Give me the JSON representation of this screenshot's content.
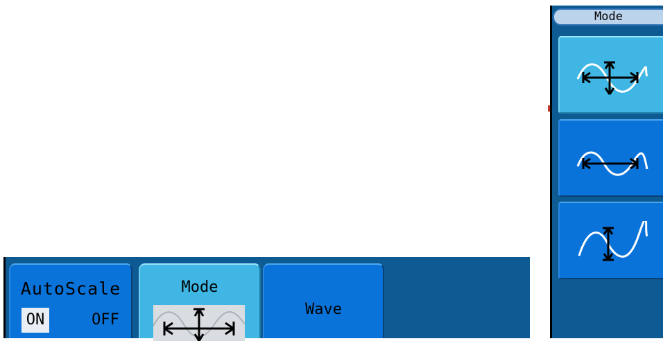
{
  "bottom_menu": {
    "autoscale": {
      "label": "AutoScale",
      "on": "ON",
      "off": "OFF",
      "selected": "ON"
    },
    "mode": {
      "label": "Mode",
      "preview_icon": "horizontal-vertical-icon"
    },
    "wave": {
      "label": "Wave"
    }
  },
  "side_menu": {
    "title": "Mode",
    "options": [
      {
        "icon": "horizontal-vertical-icon",
        "selected": true
      },
      {
        "icon": "horizontal-icon",
        "selected": false
      },
      {
        "icon": "vertical-icon",
        "selected": false
      }
    ]
  },
  "colors": {
    "bar_background": "#0e5b93",
    "button_blue": "#0a73d9",
    "button_active": "#3fb6e3",
    "header_pill": "#bcd3ec"
  }
}
